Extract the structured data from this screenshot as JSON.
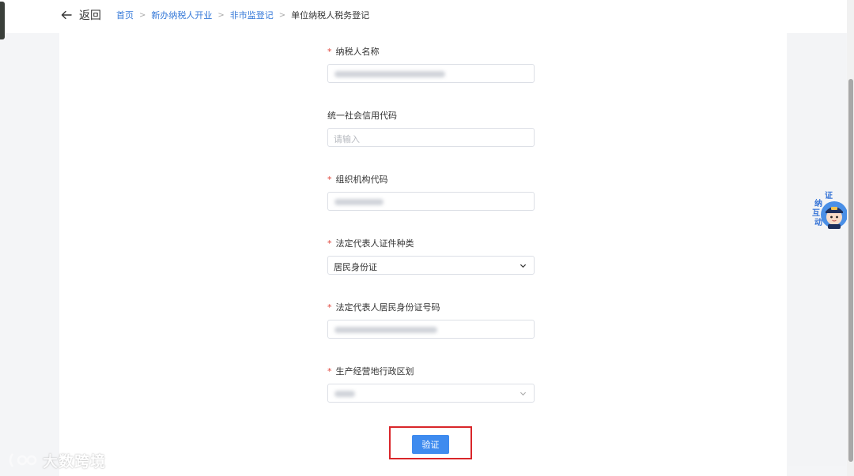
{
  "nav": {
    "back_label": "返回",
    "breadcrumb": [
      "首页",
      "新办纳税人开业",
      "非市监登记",
      "单位纳税人税务登记"
    ]
  },
  "form": {
    "fields": [
      {
        "label": "纳税人名称",
        "required": true,
        "type": "input",
        "value": "",
        "placeholder": ""
      },
      {
        "label": "统一社会信用代码",
        "required": false,
        "type": "input",
        "value": "",
        "placeholder": "请输入"
      },
      {
        "label": "组织机构代码",
        "required": true,
        "type": "input",
        "value": "",
        "placeholder": ""
      },
      {
        "label": "法定代表人证件种类",
        "required": true,
        "type": "select",
        "value": "居民身份证",
        "placeholder": ""
      },
      {
        "label": "法定代表人居民身份证号码",
        "required": true,
        "type": "input",
        "value": "",
        "placeholder": ""
      },
      {
        "label": "生产经营地行政区划",
        "required": true,
        "type": "select",
        "value": "",
        "placeholder": ""
      }
    ],
    "submit_label": "验证"
  },
  "mascot": {
    "chars": [
      "证",
      "纳",
      "互",
      "动"
    ]
  },
  "watermark": {
    "text": "大数跨境"
  },
  "colors": {
    "link": "#3478d8",
    "primary_button": "#3e8bef",
    "required_mark": "#e0463c",
    "highlight_outline": "#d9262a"
  }
}
